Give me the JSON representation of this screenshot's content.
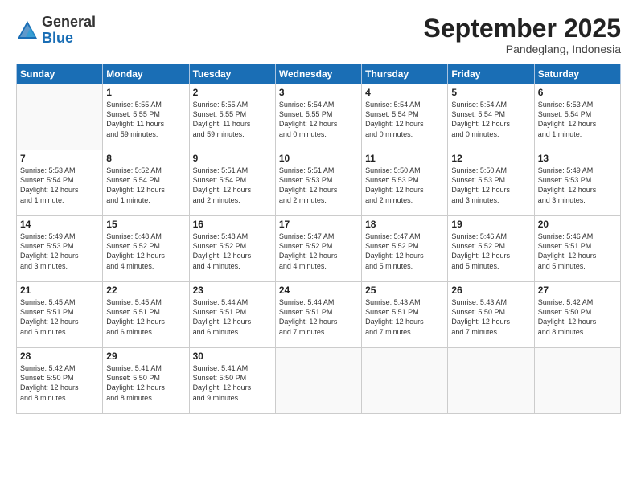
{
  "logo": {
    "general": "General",
    "blue": "Blue"
  },
  "title": "September 2025",
  "subtitle": "Pandeglang, Indonesia",
  "days": [
    "Sunday",
    "Monday",
    "Tuesday",
    "Wednesday",
    "Thursday",
    "Friday",
    "Saturday"
  ],
  "weeks": [
    [
      {
        "day": "",
        "info": ""
      },
      {
        "day": "1",
        "info": "Sunrise: 5:55 AM\nSunset: 5:55 PM\nDaylight: 11 hours\nand 59 minutes."
      },
      {
        "day": "2",
        "info": "Sunrise: 5:55 AM\nSunset: 5:55 PM\nDaylight: 11 hours\nand 59 minutes."
      },
      {
        "day": "3",
        "info": "Sunrise: 5:54 AM\nSunset: 5:55 PM\nDaylight: 12 hours\nand 0 minutes."
      },
      {
        "day": "4",
        "info": "Sunrise: 5:54 AM\nSunset: 5:54 PM\nDaylight: 12 hours\nand 0 minutes."
      },
      {
        "day": "5",
        "info": "Sunrise: 5:54 AM\nSunset: 5:54 PM\nDaylight: 12 hours\nand 0 minutes."
      },
      {
        "day": "6",
        "info": "Sunrise: 5:53 AM\nSunset: 5:54 PM\nDaylight: 12 hours\nand 1 minute."
      }
    ],
    [
      {
        "day": "7",
        "info": "Sunrise: 5:53 AM\nSunset: 5:54 PM\nDaylight: 12 hours\nand 1 minute."
      },
      {
        "day": "8",
        "info": "Sunrise: 5:52 AM\nSunset: 5:54 PM\nDaylight: 12 hours\nand 1 minute."
      },
      {
        "day": "9",
        "info": "Sunrise: 5:51 AM\nSunset: 5:54 PM\nDaylight: 12 hours\nand 2 minutes."
      },
      {
        "day": "10",
        "info": "Sunrise: 5:51 AM\nSunset: 5:53 PM\nDaylight: 12 hours\nand 2 minutes."
      },
      {
        "day": "11",
        "info": "Sunrise: 5:50 AM\nSunset: 5:53 PM\nDaylight: 12 hours\nand 2 minutes."
      },
      {
        "day": "12",
        "info": "Sunrise: 5:50 AM\nSunset: 5:53 PM\nDaylight: 12 hours\nand 3 minutes."
      },
      {
        "day": "13",
        "info": "Sunrise: 5:49 AM\nSunset: 5:53 PM\nDaylight: 12 hours\nand 3 minutes."
      }
    ],
    [
      {
        "day": "14",
        "info": "Sunrise: 5:49 AM\nSunset: 5:53 PM\nDaylight: 12 hours\nand 3 minutes."
      },
      {
        "day": "15",
        "info": "Sunrise: 5:48 AM\nSunset: 5:52 PM\nDaylight: 12 hours\nand 4 minutes."
      },
      {
        "day": "16",
        "info": "Sunrise: 5:48 AM\nSunset: 5:52 PM\nDaylight: 12 hours\nand 4 minutes."
      },
      {
        "day": "17",
        "info": "Sunrise: 5:47 AM\nSunset: 5:52 PM\nDaylight: 12 hours\nand 4 minutes."
      },
      {
        "day": "18",
        "info": "Sunrise: 5:47 AM\nSunset: 5:52 PM\nDaylight: 12 hours\nand 5 minutes."
      },
      {
        "day": "19",
        "info": "Sunrise: 5:46 AM\nSunset: 5:52 PM\nDaylight: 12 hours\nand 5 minutes."
      },
      {
        "day": "20",
        "info": "Sunrise: 5:46 AM\nSunset: 5:51 PM\nDaylight: 12 hours\nand 5 minutes."
      }
    ],
    [
      {
        "day": "21",
        "info": "Sunrise: 5:45 AM\nSunset: 5:51 PM\nDaylight: 12 hours\nand 6 minutes."
      },
      {
        "day": "22",
        "info": "Sunrise: 5:45 AM\nSunset: 5:51 PM\nDaylight: 12 hours\nand 6 minutes."
      },
      {
        "day": "23",
        "info": "Sunrise: 5:44 AM\nSunset: 5:51 PM\nDaylight: 12 hours\nand 6 minutes."
      },
      {
        "day": "24",
        "info": "Sunrise: 5:44 AM\nSunset: 5:51 PM\nDaylight: 12 hours\nand 7 minutes."
      },
      {
        "day": "25",
        "info": "Sunrise: 5:43 AM\nSunset: 5:51 PM\nDaylight: 12 hours\nand 7 minutes."
      },
      {
        "day": "26",
        "info": "Sunrise: 5:43 AM\nSunset: 5:50 PM\nDaylight: 12 hours\nand 7 minutes."
      },
      {
        "day": "27",
        "info": "Sunrise: 5:42 AM\nSunset: 5:50 PM\nDaylight: 12 hours\nand 8 minutes."
      }
    ],
    [
      {
        "day": "28",
        "info": "Sunrise: 5:42 AM\nSunset: 5:50 PM\nDaylight: 12 hours\nand 8 minutes."
      },
      {
        "day": "29",
        "info": "Sunrise: 5:41 AM\nSunset: 5:50 PM\nDaylight: 12 hours\nand 8 minutes."
      },
      {
        "day": "30",
        "info": "Sunrise: 5:41 AM\nSunset: 5:50 PM\nDaylight: 12 hours\nand 9 minutes."
      },
      {
        "day": "",
        "info": ""
      },
      {
        "day": "",
        "info": ""
      },
      {
        "day": "",
        "info": ""
      },
      {
        "day": "",
        "info": ""
      }
    ]
  ]
}
